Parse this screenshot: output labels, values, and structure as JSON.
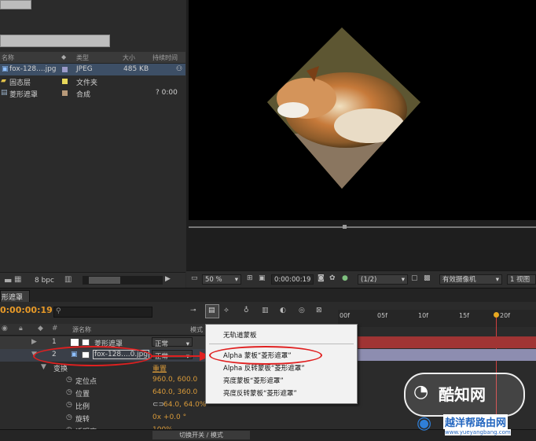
{
  "project": {
    "columns": {
      "name": "名称",
      "type": "类型",
      "size": "大小",
      "duration": "持续时间"
    },
    "items": [
      {
        "name": "fox-128....jpg",
        "type": "JPEG",
        "size": "485 KB",
        "duration": "",
        "color": "#9a9ac8"
      },
      {
        "name": "固态层",
        "type": "文件夹",
        "size": "",
        "duration": "",
        "color": "#e8d85a"
      },
      {
        "name": "菱形遮罩",
        "type": "合成",
        "size": "",
        "duration": "? 0:00",
        "color": "#b89a7a"
      }
    ],
    "bpc": "8 bpc"
  },
  "viewer": {
    "zoom": "50 %",
    "timecode": "0:00:00:19",
    "resolution": "(1/2)",
    "camera": "有效摄像机",
    "views": "1 视图"
  },
  "timeline": {
    "tab": "形遮罩",
    "timecode": "0:00:00:19",
    "header": {
      "source": "源名称",
      "mode": "模式"
    },
    "ruler": [
      "00f",
      "05f",
      "10f",
      "15f",
      "20f"
    ],
    "layers": [
      {
        "num": "1",
        "name": "菱形遮罩",
        "mode": "正常"
      },
      {
        "num": "2",
        "name": "fox-128....0.jpg",
        "mode": "正常"
      }
    ],
    "transform": {
      "label": "变换",
      "reset": "重置"
    },
    "props": [
      {
        "name": "定位点",
        "value": "960.0, 600.0"
      },
      {
        "name": "位置",
        "value": "640.0, 360.0"
      },
      {
        "name": "比例",
        "value": "64.0, 64.0%"
      },
      {
        "name": "旋转",
        "value": "0x +0.0 °"
      },
      {
        "name": "透明度",
        "value": "100%"
      }
    ],
    "footer": "切换开关 / 模式"
  },
  "menu": {
    "items": [
      "无轨道蒙板",
      "Alpha 蒙板“菱形遮罩”",
      "Alpha 反转蒙板“菱形遮罩”",
      "亮度蒙板“菱形遮罩”",
      "亮度反转蒙板“菱形遮罩”"
    ]
  },
  "watermark": {
    "brand": "酷知网",
    "site": "越洋帮路由网",
    "url": "www.yueyangbang.com"
  }
}
